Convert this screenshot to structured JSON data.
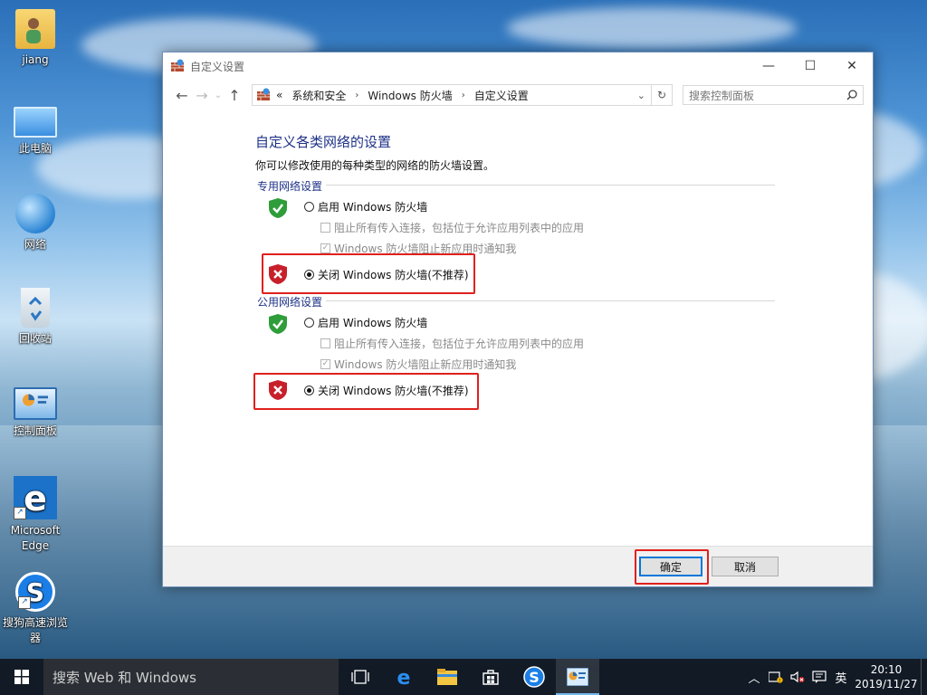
{
  "desktop": {
    "icons": [
      {
        "label": "jiang",
        "icon": "user-folder-icon"
      },
      {
        "label": "此电脑",
        "icon": "computer-icon"
      },
      {
        "label": "网络",
        "icon": "network-globe-icon"
      },
      {
        "label": "回收站",
        "icon": "recycle-bin-icon"
      },
      {
        "label": "控制面板",
        "icon": "control-panel-icon"
      },
      {
        "label": "Microsoft Edge",
        "icon": "edge-icon"
      },
      {
        "label": "搜狗高速浏览器",
        "icon": "sogou-browser-icon"
      }
    ]
  },
  "window": {
    "title": "自定义设置",
    "controls": {
      "minimize": "—",
      "maximize": "☐",
      "close": "✕"
    },
    "address": {
      "overflow": "«",
      "crumbs": [
        "系统和安全",
        "Windows 防火墙",
        "自定义设置"
      ]
    },
    "search_placeholder": "搜索控制面板",
    "heading": "自定义各类网络的设置",
    "description": "你可以修改使用的每种类型的网络的防火墙设置。",
    "private": {
      "section_label": "专用网络设置",
      "enable_label": "启用 Windows 防火墙",
      "block_all_label": "阻止所有传入连接，包括位于允许应用列表中的应用",
      "notify_label": "Windows 防火墙阻止新应用时通知我",
      "disable_label": "关闭 Windows 防火墙(不推荐)",
      "selected": "disable",
      "block_all_checked": false,
      "notify_checked": true
    },
    "public": {
      "section_label": "公用网络设置",
      "enable_label": "启用 Windows 防火墙",
      "block_all_label": "阻止所有传入连接，包括位于允许应用列表中的应用",
      "notify_label": "Windows 防火墙阻止新应用时通知我",
      "disable_label": "关闭 Windows 防火墙(不推荐)",
      "selected": "disable",
      "block_all_checked": false,
      "notify_checked": true
    },
    "buttons": {
      "ok": "确定",
      "cancel": "取消"
    },
    "highlight_color": "#e0201d"
  },
  "taskbar": {
    "search_placeholder": "搜索 Web 和 Windows",
    "apps": [
      "task-view-icon",
      "edge-icon",
      "file-explorer-icon",
      "store-icon",
      "sogou-browser-icon",
      "control-panel-icon"
    ],
    "active_app": "control-panel-icon",
    "tray": {
      "ime": "英",
      "time": "20:10",
      "date": "2019/11/27"
    }
  }
}
